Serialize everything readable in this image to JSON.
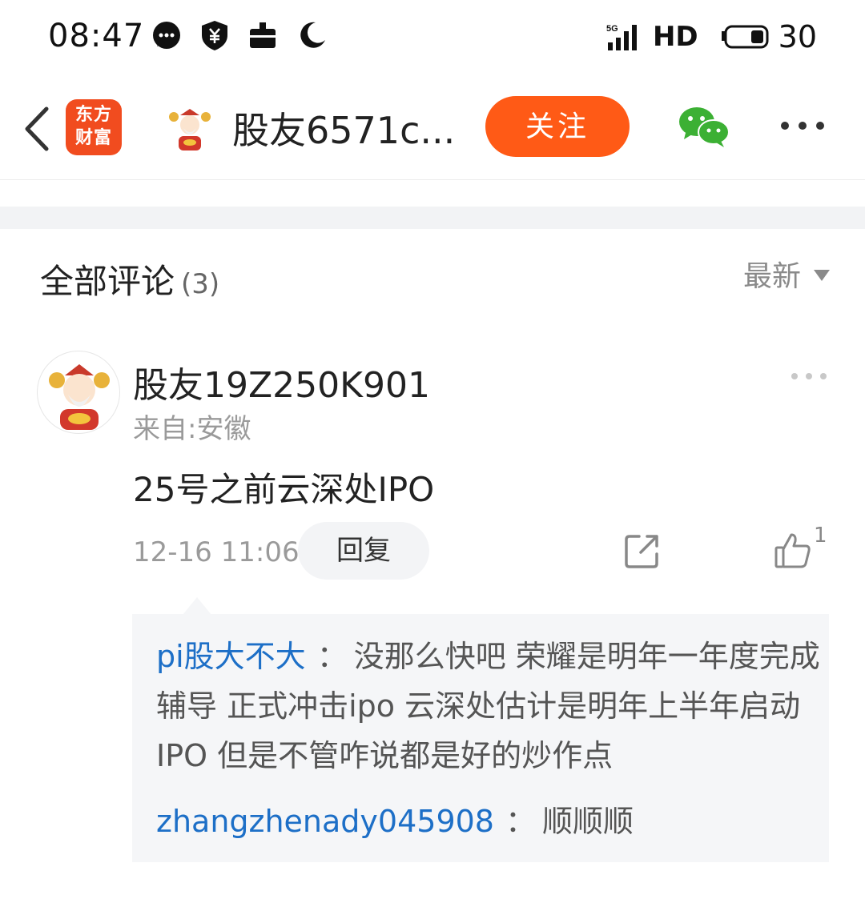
{
  "status_bar": {
    "time": "08:47",
    "network": "5G",
    "hd": "HD",
    "battery": "30",
    "icons": [
      "chat-bubble-icon",
      "shield-yuan-icon",
      "work-icon",
      "moon-icon",
      "signal-icon",
      "battery-icon"
    ]
  },
  "header": {
    "app_logo_line1": "东方",
    "app_logo_line2": "财富",
    "title": "股友6571c...",
    "follow_label": "关注",
    "accent_color": "#ff5a16"
  },
  "comments": {
    "title": "全部评论",
    "count": "(3)",
    "sort_label": "最新",
    "items": [
      {
        "user": "股友19Z250K901",
        "location": "来自:安徽",
        "text": "25号之前云深处IPO",
        "time": "12-16 11:06",
        "reply_label": "回复",
        "likes": "1",
        "replies": [
          {
            "user": "pi股大不大",
            "separator": "：",
            "text": "没那么快吧 荣耀是明年一年度完成辅导 正式冲击ipo 云深处估计是明年上半年启动IPO 但是不管咋说都是好的炒作点"
          },
          {
            "user": "zhangzhenady045908",
            "separator": "：",
            "text": "顺顺顺"
          }
        ]
      }
    ]
  }
}
